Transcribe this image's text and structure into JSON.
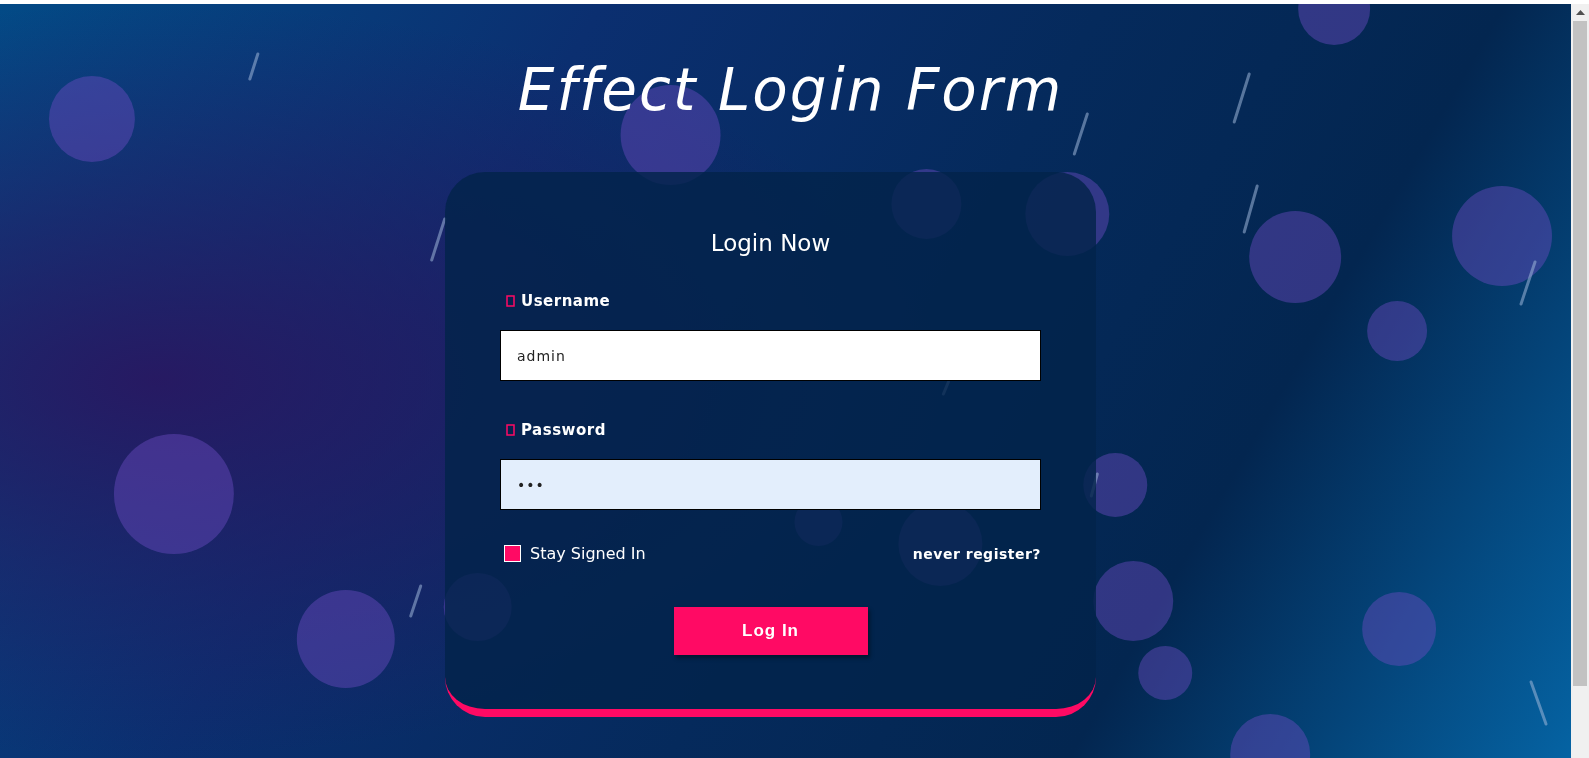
{
  "title": "Effect Login Form",
  "form": {
    "heading": "Login Now",
    "fields": [
      {
        "label": "Username",
        "value": "admin",
        "kind": "text",
        "focused": false
      },
      {
        "label": "Password",
        "value": "•••",
        "kind": "password",
        "focused": true
      }
    ],
    "remember": {
      "label": "Stay Signed In",
      "checked": true
    },
    "register_link": "never register?",
    "submit": "Log In"
  }
}
